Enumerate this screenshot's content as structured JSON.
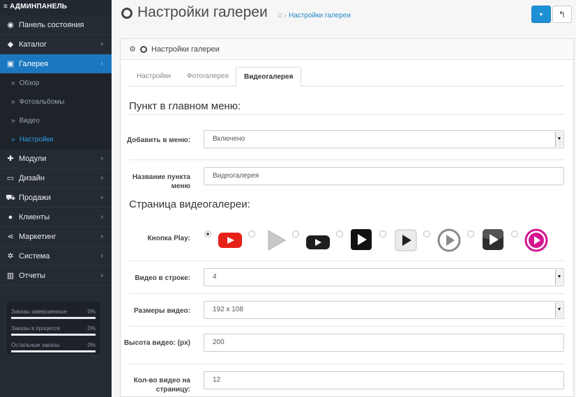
{
  "sidebar": {
    "brand": "≡ АДМИНПАНЕЛЬ",
    "items": [
      {
        "label": "Панель состояния",
        "icon": "dashboard-icon",
        "glyph": "◉",
        "has_sub": false
      },
      {
        "label": "Каталог",
        "icon": "tag-icon",
        "glyph": "◆",
        "has_sub": true
      },
      {
        "label": "Галерея",
        "icon": "image-icon",
        "glyph": "▣",
        "has_sub": true,
        "active": true
      },
      {
        "label": "Модули",
        "icon": "puzzle-icon",
        "glyph": "✚",
        "has_sub": true
      },
      {
        "label": "Дизайн",
        "icon": "monitor-icon",
        "glyph": "▭",
        "has_sub": true
      },
      {
        "label": "Продажи",
        "icon": "cart-icon",
        "glyph": "⛟",
        "has_sub": true
      },
      {
        "label": "Клиенты",
        "icon": "user-icon",
        "glyph": "●",
        "has_sub": true
      },
      {
        "label": "Маркетинг",
        "icon": "share-icon",
        "glyph": "⋖",
        "has_sub": true
      },
      {
        "label": "Система",
        "icon": "cog-icon",
        "glyph": "✲",
        "has_sub": true
      },
      {
        "label": "Отчеты",
        "icon": "bar-chart-icon",
        "glyph": "▥",
        "has_sub": true
      }
    ],
    "gallery_sub": [
      {
        "label": "Обзор"
      },
      {
        "label": "Фотоальбомы"
      },
      {
        "label": "Видео"
      },
      {
        "label": "Настройки",
        "active": true
      }
    ],
    "stats": [
      {
        "label": "Заказы завершенные",
        "percent": "0%",
        "fill": 0
      },
      {
        "label": "Заказы в процессе",
        "percent": "0%",
        "fill": 0
      },
      {
        "label": "Остальные заказы",
        "percent": "0%",
        "fill": 0
      }
    ]
  },
  "header": {
    "title": "Настройки галереи",
    "breadcrumb_current": "Настройки галереи"
  },
  "panel": {
    "title": "Настройки галереи",
    "tabs": [
      {
        "label": "Настройки"
      },
      {
        "label": "Фотогалерея"
      },
      {
        "label": "Видеогалерея",
        "active": true
      }
    ],
    "section_menu": "Пункт в главном меню:",
    "section_page": "Страница видеогалереи:",
    "fields": {
      "add_to_menu": {
        "label": "Добавить в меню:",
        "value": "Включено"
      },
      "menu_name": {
        "label": "Название пункта меню",
        "value": "Видеогалерея"
      },
      "play_button": {
        "label": "Кнопка Play:",
        "selected_index": 0,
        "options": [
          "youtube-red",
          "grey-triangle",
          "black-rounded",
          "black-square",
          "grey-square",
          "grey-circle",
          "dark-glossy",
          "magenta-circle"
        ]
      },
      "videos_per_row": {
        "label": "Видео в строке:",
        "value": "4"
      },
      "video_size": {
        "label": "Размеры видео:",
        "value": "192 x 108"
      },
      "video_height": {
        "label": "Высота видео: (px)",
        "value": "200"
      },
      "videos_per_page": {
        "label": "Кол-во видео на страницу:",
        "value": "12"
      }
    }
  },
  "colors": {
    "sidebar_bg": "#252b33",
    "accent": "#1b78c0",
    "link": "#1e88c8",
    "youtube_red": "#e62117",
    "magenta": "#d4148f"
  }
}
